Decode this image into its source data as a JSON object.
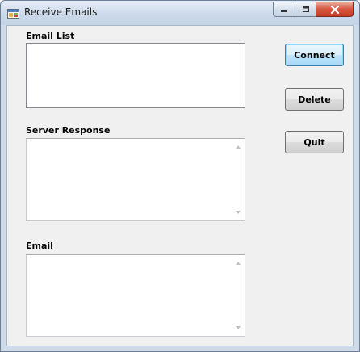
{
  "window": {
    "title": "Receive Emails",
    "icon": "app-window-icon",
    "controls": [
      "minimize-icon",
      "maximize-icon",
      "close-icon"
    ]
  },
  "labels": {
    "email_list": "Email List",
    "server_response": "Server Response",
    "email": "Email"
  },
  "fields": {
    "email_list_items": [],
    "server_response_text": "",
    "email_text": ""
  },
  "buttons": {
    "connect": "Connect",
    "delete": "Delete",
    "quit": "Quit"
  },
  "colors": {
    "default_button_accent": "#3c7fb1",
    "close_button": "#c33c25"
  }
}
